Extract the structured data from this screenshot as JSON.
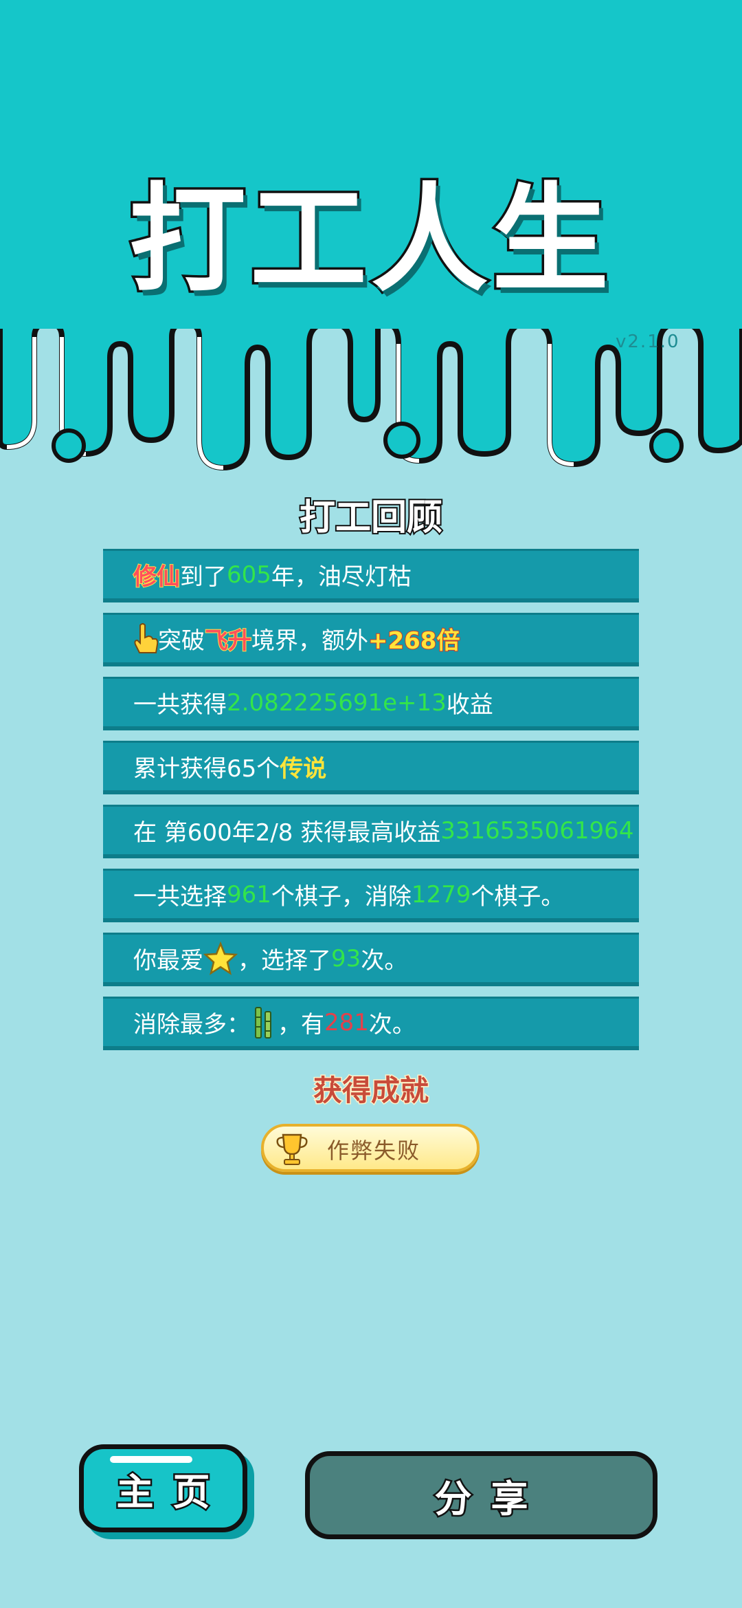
{
  "app": {
    "title": "打工人生",
    "version": "v2.1.0"
  },
  "review": {
    "title": "打工回顾",
    "rows": [
      {
        "parts": [
          "修仙",
          "到了",
          "605",
          "年，油尽灯枯"
        ]
      },
      {
        "parts": [
          "突破",
          "飞升",
          "境界，额外",
          "+268倍"
        ]
      },
      {
        "parts": [
          "一共获得",
          "2.082225691e+13",
          "收益"
        ]
      },
      {
        "parts": [
          "累计获得65个",
          "传说"
        ]
      },
      {
        "parts": [
          "在 第600年2/8 获得最高收益",
          "3316535061964"
        ]
      },
      {
        "parts": [
          "一共选择",
          "961",
          "个棋子，消除",
          "1279",
          "个棋子。"
        ]
      },
      {
        "parts": [
          "你最爱",
          "，选择了",
          "93",
          "次。"
        ]
      },
      {
        "parts": [
          "消除最多：",
          "，有",
          "281",
          "次。"
        ]
      }
    ]
  },
  "achievements": {
    "title": "获得成就",
    "items": [
      {
        "label": "作弊失败",
        "icon": "trophy-icon"
      }
    ]
  },
  "buttons": {
    "home": "主页",
    "share": "分享"
  },
  "colors": {
    "top_bg": "#15c6c9",
    "page_bg": "#a2e0e6",
    "row_bg": "#159aaa",
    "highlight_green": "#33e54a",
    "highlight_red": "#e5414a",
    "share_bg": "#4b817e"
  }
}
